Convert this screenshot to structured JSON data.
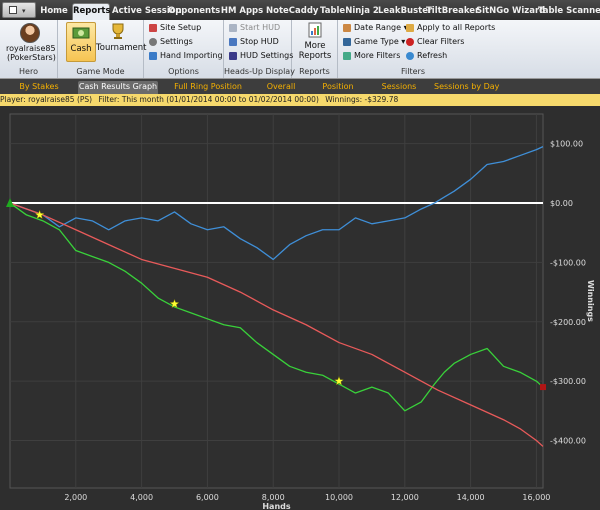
{
  "main_tabs": [
    {
      "label": "Home",
      "active": false
    },
    {
      "label": "Reports",
      "active": true
    },
    {
      "label": "Active Session",
      "active": false
    },
    {
      "label": "Opponents",
      "active": false
    },
    {
      "label": "HM Apps",
      "active": false
    },
    {
      "label": "NoteCaddy",
      "active": false
    },
    {
      "label": "TableNinja 2",
      "active": false
    },
    {
      "label": "LeakBuster",
      "active": false
    },
    {
      "label": "TiltBreaker",
      "active": false
    },
    {
      "label": "SitNGo Wizard",
      "active": false
    },
    {
      "label": "Table Scanner",
      "active": false
    }
  ],
  "ribbon": {
    "hero": {
      "name": "royalraise85",
      "site": "(PokerStars)",
      "group": "Hero"
    },
    "game_mode": {
      "cash": "Cash",
      "tournament": "Tournament",
      "group": "Game Mode"
    },
    "options": {
      "site_setup": "Site Setup",
      "settings": "Settings",
      "hand_importing": "Hand Importing",
      "group": "Options"
    },
    "hud": {
      "start": "Start HUD",
      "stop": "Stop HUD",
      "settings": "HUD Settings",
      "group": "Heads-Up Display"
    },
    "reports": {
      "more_line1": "More",
      "more_line2": "Reports",
      "group": "Reports"
    },
    "filters": {
      "date_range": "Date Range",
      "game_type": "Game Type",
      "more_filters": "More Filters",
      "apply_all": "Apply to all Reports",
      "clear": "Clear Filters",
      "refresh": "Refresh",
      "group": "Filters"
    }
  },
  "sub_tabs": [
    {
      "label": "By Stakes",
      "active": false
    },
    {
      "label": "Cash Results Graph",
      "active": true
    },
    {
      "label": "Full Ring Position",
      "active": false
    },
    {
      "label": "Overall",
      "active": false
    },
    {
      "label": "Position",
      "active": false
    },
    {
      "label": "Sessions",
      "active": false
    },
    {
      "label": "Sessions by Day",
      "active": false
    }
  ],
  "info_bar": {
    "player": "Player: royalraise85 (PS)",
    "filter": "Filter: This month (01/01/2014 00:00 to 01/02/2014 00:00)",
    "winnings": "Winnings: -$329.78"
  },
  "colors": {
    "blue": "#3f8fd8",
    "red": "#e85a5a",
    "green": "#39d13a",
    "zero": "#ffffff",
    "marker": "#ffff33",
    "start": "#1faa1f",
    "end": "#b01515"
  },
  "chart_data": {
    "type": "line",
    "xlabel": "Hands",
    "ylabel": "Winnings",
    "xlim": [
      0,
      16200
    ],
    "ylim": [
      -480,
      150
    ],
    "x_ticks": [
      2000,
      4000,
      6000,
      8000,
      10000,
      12000,
      14000,
      16000
    ],
    "x_tick_labels": [
      "2,000",
      "4,000",
      "6,000",
      "8,000",
      "10,000",
      "12,000",
      "14,000",
      "16,000"
    ],
    "y_ticks": [
      100,
      0,
      -100,
      -200,
      -300,
      -400
    ],
    "y_tick_labels": [
      "$100.00",
      "$0.00",
      "-$100.00",
      "-$200.00",
      "-$300.00",
      "-$400.00"
    ],
    "grid": true,
    "zero_line": 0,
    "series": [
      {
        "color_key": "blue",
        "x": [
          0,
          500,
          1000,
          1500,
          2000,
          2500,
          3000,
          3500,
          4000,
          4500,
          5000,
          5500,
          6000,
          6500,
          7000,
          7500,
          8000,
          8500,
          9000,
          9500,
          10000,
          10500,
          11000,
          11500,
          12000,
          12500,
          12900,
          13200,
          13500,
          14000,
          14500,
          15000,
          15500,
          16000,
          16200
        ],
        "y": [
          0,
          -10,
          -20,
          -40,
          -25,
          -30,
          -45,
          -30,
          -25,
          -30,
          -15,
          -35,
          -45,
          -40,
          -60,
          -75,
          -95,
          -70,
          -55,
          -45,
          -45,
          -25,
          -35,
          -30,
          -25,
          -10,
          0,
          10,
          20,
          40,
          65,
          70,
          80,
          90,
          95
        ]
      },
      {
        "color_key": "green",
        "x": [
          0,
          500,
          1000,
          1500,
          2000,
          2500,
          3000,
          3500,
          4000,
          4500,
          5000,
          5500,
          6000,
          6500,
          7000,
          7500,
          8000,
          8500,
          9000,
          9500,
          10000,
          10500,
          11000,
          11500,
          12000,
          12500,
          12900,
          13200,
          13500,
          14000,
          14500,
          15000,
          15500,
          16000,
          16200
        ],
        "y": [
          0,
          -20,
          -30,
          -45,
          -80,
          -90,
          -100,
          -115,
          -135,
          -160,
          -175,
          -185,
          -195,
          -205,
          -210,
          -235,
          -255,
          -275,
          -285,
          -290,
          -305,
          -320,
          -310,
          -320,
          -350,
          -335,
          -305,
          -285,
          -270,
          -255,
          -245,
          -275,
          -285,
          -300,
          -310
        ]
      },
      {
        "color_key": "red",
        "x": [
          0,
          1000,
          2000,
          3000,
          4000,
          5000,
          6000,
          7000,
          8000,
          9000,
          10000,
          11000,
          12000,
          13000,
          14000,
          15000,
          15500,
          16000,
          16200
        ],
        "y": [
          0,
          -20,
          -45,
          -70,
          -95,
          -110,
          -125,
          -150,
          -180,
          -205,
          -235,
          -255,
          -285,
          -315,
          -340,
          -365,
          -380,
          -400,
          -410
        ]
      }
    ],
    "markers": [
      {
        "x": 900,
        "y": -20
      },
      {
        "x": 5000,
        "y": -170
      },
      {
        "x": 10000,
        "y": -300
      }
    ]
  }
}
